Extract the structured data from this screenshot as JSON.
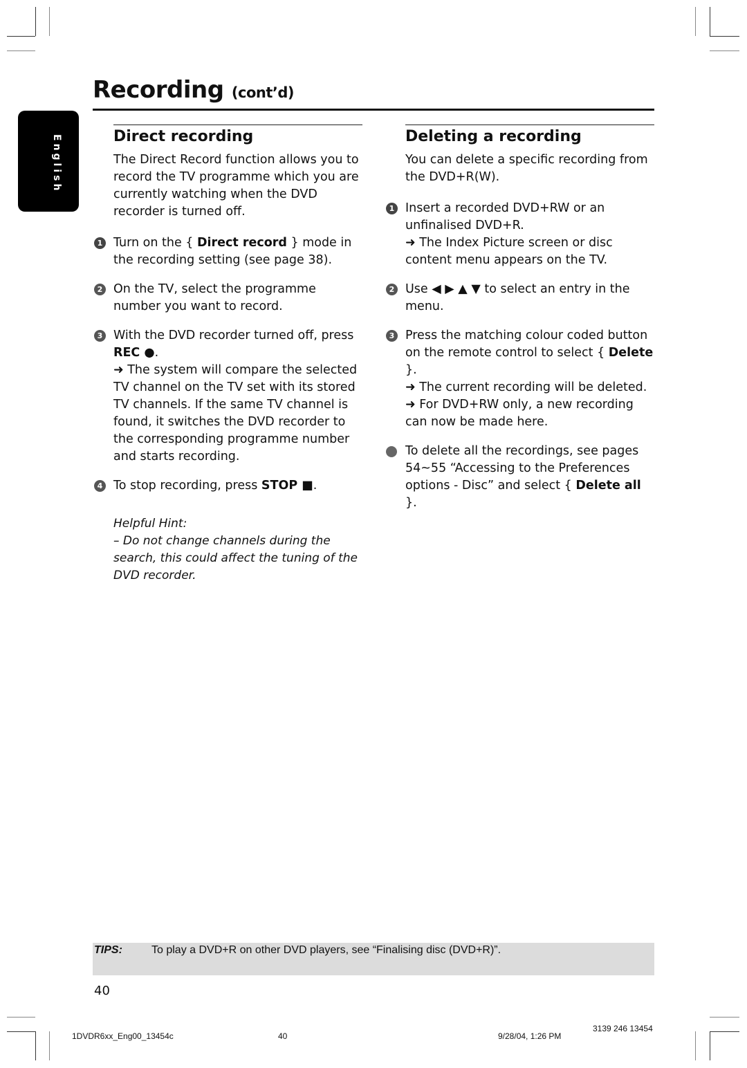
{
  "header": {
    "title": "Recording",
    "title_suffix": "(cont’d)",
    "language_tab": "English"
  },
  "left_section": {
    "title": "Direct recording",
    "intro": "The Direct Record function allows you to record the TV programme which you are currently watching when the DVD recorder is turned off.",
    "steps": [
      {
        "number": "1",
        "text_before": "Turn on the { ",
        "bold": "Direct record",
        "text_after": " } mode in the recording setting (see page 38)."
      },
      {
        "number": "2",
        "text": "On the TV, select the programme number you want to record."
      },
      {
        "number": "3",
        "text_before": "With the DVD recorder turned off, press ",
        "bold": "REC ●",
        "text_after": ".",
        "result": "➜ The system will compare the selected TV channel on the TV set with its stored TV channels.  If the same TV channel is found, it switches the DVD recorder to the corresponding programme number and starts recording."
      },
      {
        "number": "4",
        "text_before": "To stop recording, press ",
        "bold": "STOP ■",
        "text_after": "."
      }
    ],
    "hint_title": "Helpful Hint:",
    "hint_text": "–  Do not change channels during the search, this could affect the tuning of the DVD recorder."
  },
  "right_section": {
    "title": "Deleting a recording",
    "intro": "You can delete a specific recording from the DVD+R(W).",
    "steps": [
      {
        "number": "1",
        "text": "Insert a recorded DVD+RW or an unfinalised DVD+R.",
        "result": "➜ The Index Picture screen or disc content menu appears on the TV."
      },
      {
        "number": "2",
        "text": "Use ◀ ▶ ▲ ▼ to select an entry in the menu."
      },
      {
        "number": "3",
        "text_before": "Press the matching colour coded button on the remote control to select { ",
        "bold": "Delete",
        "text_after": " }.",
        "result1": "➜ The current recording will be deleted.",
        "result2": "➜ For DVD+RW only, a new recording can now be made here."
      },
      {
        "text_before": "To delete all the recordings, see pages 54~55 “Accessing to the Preferences options - Disc” and select { ",
        "bold": "Delete all",
        "text_after": " }."
      }
    ]
  },
  "tips": {
    "label": "TIPS:",
    "text": "To play a DVD+R on other DVD players, see “Finalising disc (DVD+R)”."
  },
  "page_number": "40",
  "print_footer": {
    "file": "1DVDR6xx_Eng00_13454c",
    "page": "40",
    "datetime": "9/28/04, 1:26 PM",
    "code": "3139 246 13454"
  }
}
